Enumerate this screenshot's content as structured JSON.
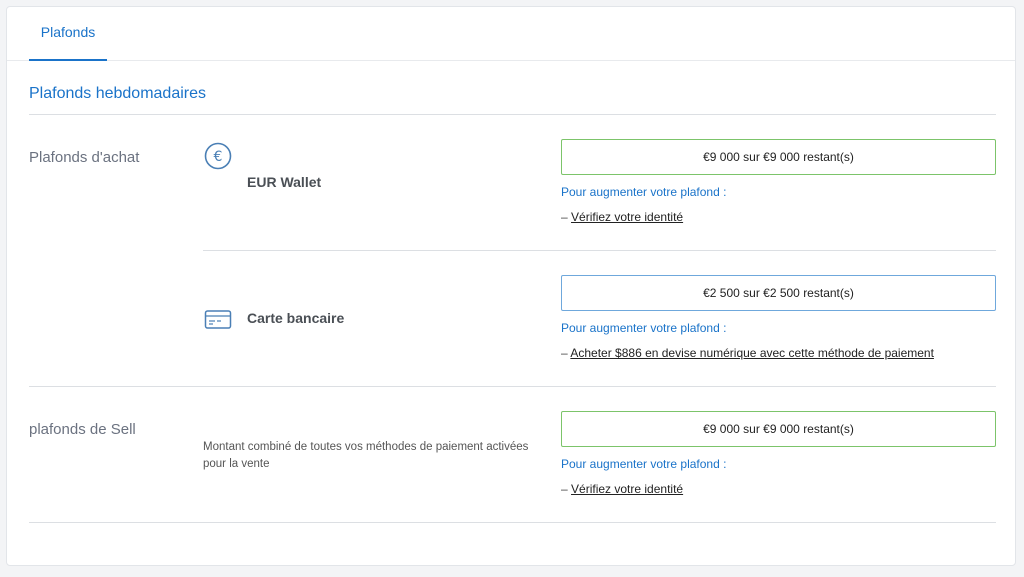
{
  "tabs": [
    {
      "label": "Plafonds"
    }
  ],
  "section_title": "Plafonds hebdomadaires",
  "purchase": {
    "label": "Plafonds d'achat",
    "methods": [
      {
        "name": "EUR Wallet",
        "icon": "euro-coin-icon",
        "limit": "€9 000 sur €9 000 restant(s)",
        "increase_label": "Pour augmenter votre plafond :",
        "dash": "–",
        "action": "Vérifiez votre identité"
      },
      {
        "name": "Carte bancaire",
        "icon": "credit-card-icon",
        "limit": "€2 500 sur €2 500 restant(s)",
        "increase_label": "Pour augmenter votre plafond :",
        "dash": "–",
        "action": "Acheter $886 en devise numérique avec cette méthode de paiement"
      }
    ]
  },
  "sell": {
    "label": "plafonds de Sell",
    "description": "Montant combiné de toutes vos méthodes de paiement activées pour la vente",
    "limit": "€9 000 sur €9 000 restant(s)",
    "increase_label": "Pour augmenter votre plafond :",
    "dash": "–",
    "action": "Vérifiez votre identité"
  },
  "colors": {
    "accent": "#1a73c9",
    "green_border": "#7cc46a",
    "blue_border": "#6fa8dc"
  }
}
